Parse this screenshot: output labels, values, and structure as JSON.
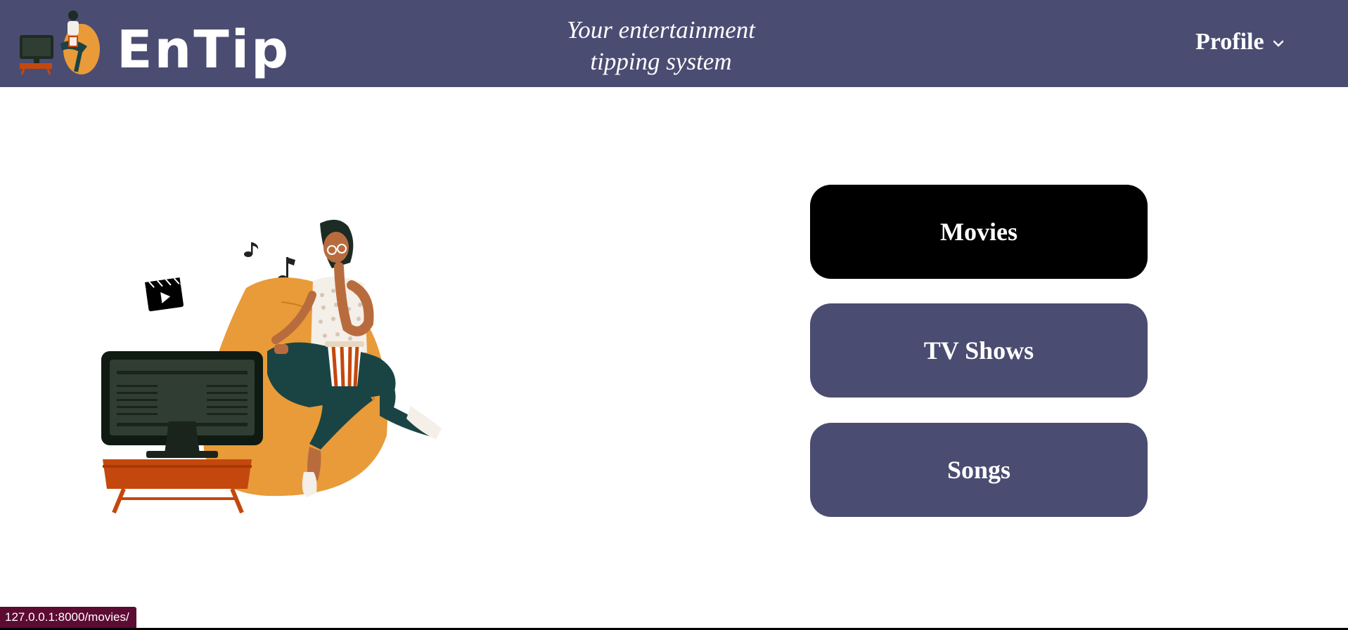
{
  "header": {
    "logo_text": "EnTip",
    "tagline_line1": "Your entertainment",
    "tagline_line2": "tipping system",
    "profile_label": "Profile"
  },
  "categories": [
    {
      "label": "Movies",
      "active": true
    },
    {
      "label": "TV Shows",
      "active": false
    },
    {
      "label": "Songs",
      "active": false
    }
  ],
  "status_bar": {
    "url": "127.0.0.1:8000/movies/"
  },
  "colors": {
    "header_bg": "#4b4c72",
    "button_bg": "#4b4c72",
    "button_active_bg": "#000000",
    "status_bg": "#5c0b33",
    "beanbag": "#e89b38",
    "tv_stand": "#c4480d"
  }
}
